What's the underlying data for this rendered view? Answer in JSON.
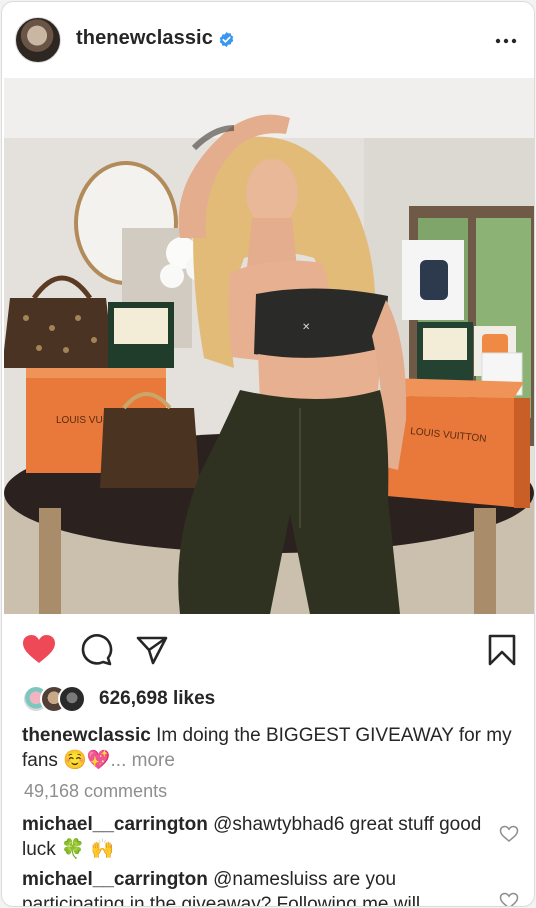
{
  "post": {
    "username": "thenewclassic",
    "verified": true,
    "likes": "626,698 likes",
    "caption_user": "thenewclassic",
    "caption_text": "Im doing the BIGGEST GIVEAWAY for my fans",
    "caption_emojis": "☺️💖",
    "caption_more": "... more",
    "comments_link": "49,168 comments",
    "photo_text": {
      "box_left_brand": "LOUIS VU",
      "box_right_brand": "LOUIS VUITTON"
    }
  },
  "comments": [
    {
      "user": "michael__carrington",
      "text": "@shawtybhad6 great stuff good luck",
      "emojis": "🍀 🙌"
    },
    {
      "user": "michael__carrington",
      "text": "@namesluiss are you participating in the giveaway? Following me will"
    }
  ],
  "colors": {
    "like_red": "#ed4956",
    "verified_blue": "#3897f0",
    "muted": "#8e8e8e",
    "box_orange": "#e8793a"
  },
  "icons": [
    "verified-badge-icon",
    "more-options-icon",
    "heart-filled-icon",
    "comment-icon",
    "share-icon",
    "bookmark-icon",
    "heart-outline-icon"
  ]
}
